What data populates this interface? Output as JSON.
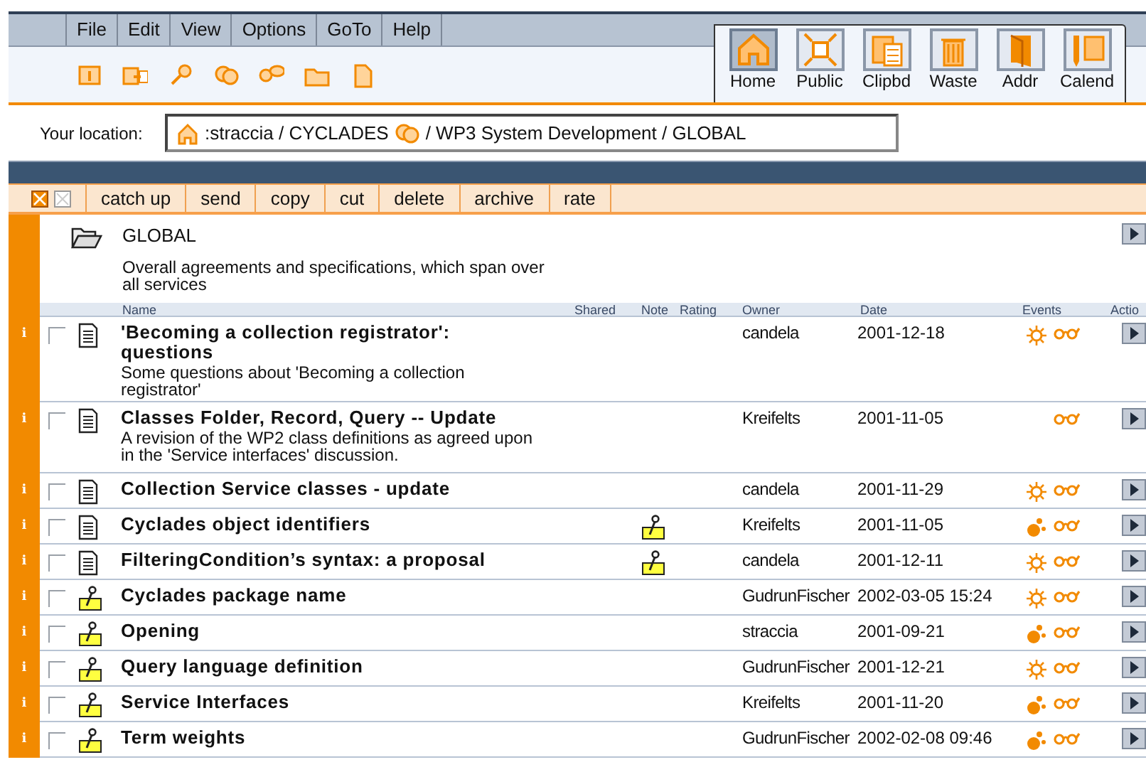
{
  "menu": [
    "File",
    "Edit",
    "View",
    "Options",
    "GoTo",
    "Help"
  ],
  "big_buttons": [
    {
      "label": "Home",
      "selected": true
    },
    {
      "label": "Public",
      "selected": false
    },
    {
      "label": "Clipbd",
      "selected": false
    },
    {
      "label": "Waste",
      "selected": false
    },
    {
      "label": "Addr",
      "selected": false
    },
    {
      "label": "Calend",
      "selected": false
    }
  ],
  "location": {
    "label": "Your location:",
    "path_start": ":straccia / CYCLADES",
    "path_end": "/ WP3 System Development / GLOBAL"
  },
  "actions": [
    "catch up",
    "send",
    "copy",
    "cut",
    "delete",
    "archive",
    "rate"
  ],
  "folder": {
    "name": "GLOBAL",
    "description": "Overall agreements and specifications, which span over all services"
  },
  "columns": [
    "Name",
    "Shared",
    "Note",
    "Rating",
    "Owner",
    "Date",
    "Events",
    "Actio"
  ],
  "rows": [
    {
      "info": "i",
      "checked": false,
      "kind": "document",
      "title": "'Becoming a collection registrator': questions",
      "description": "Some questions about 'Becoming a collection registrator'",
      "note": false,
      "owner": "candela",
      "date": "2001-12-18",
      "event": {
        "kind": "new"
      }
    },
    {
      "info": "i",
      "checked": false,
      "kind": "document",
      "title": "Classes Folder, Record, Query -- Update",
      "description": "A revision of the WP2 class definitions as agreed upon in the 'Service interfaces' discussion.",
      "note": false,
      "owner": "Kreifelts",
      "date": "2001-11-05"
    },
    {
      "info": "i",
      "checked": false,
      "kind": "document",
      "title": "Collection Service classes - update",
      "note": false,
      "owner": "candela",
      "date": "2001-11-29",
      "event": {
        "kind": "new"
      }
    },
    {
      "info": "i",
      "checked": false,
      "kind": "document",
      "title": "Cyclades object identifiers",
      "note": true,
      "owner": "Kreifelts",
      "date": "2001-11-05",
      "event": {
        "kind": "changed"
      }
    },
    {
      "info": "i",
      "checked": false,
      "kind": "document",
      "title": "FilteringCondition’s syntax: a proposal",
      "note": true,
      "owner": "candela",
      "date": "2001-12-11",
      "event": {
        "kind": "new"
      }
    },
    {
      "info": "i",
      "checked": false,
      "kind": "note",
      "title": "Cyclades package name",
      "note": false,
      "owner": "GudrunFischer",
      "date": "2002-03-05 15:24",
      "event": {
        "kind": "new"
      }
    },
    {
      "info": "i",
      "checked": false,
      "kind": "note",
      "title": "Opening",
      "note": false,
      "owner": "straccia",
      "date": "2001-09-21",
      "event": {
        "kind": "changed"
      }
    },
    {
      "info": "i",
      "checked": false,
      "kind": "note",
      "title": "Query language definition",
      "note": false,
      "owner": "GudrunFischer",
      "date": "2001-12-21",
      "event": {
        "kind": "new"
      }
    },
    {
      "info": "i",
      "checked": false,
      "kind": "note",
      "title": "Service Interfaces",
      "note": false,
      "owner": "Kreifelts",
      "date": "2001-11-20",
      "event": {
        "kind": "changed"
      }
    },
    {
      "info": "i",
      "checked": false,
      "kind": "note",
      "title": "Term weights",
      "note": false,
      "owner": "GudrunFischer",
      "date": "2002-02-08 09:46",
      "event": {
        "kind": "changed"
      }
    }
  ]
}
